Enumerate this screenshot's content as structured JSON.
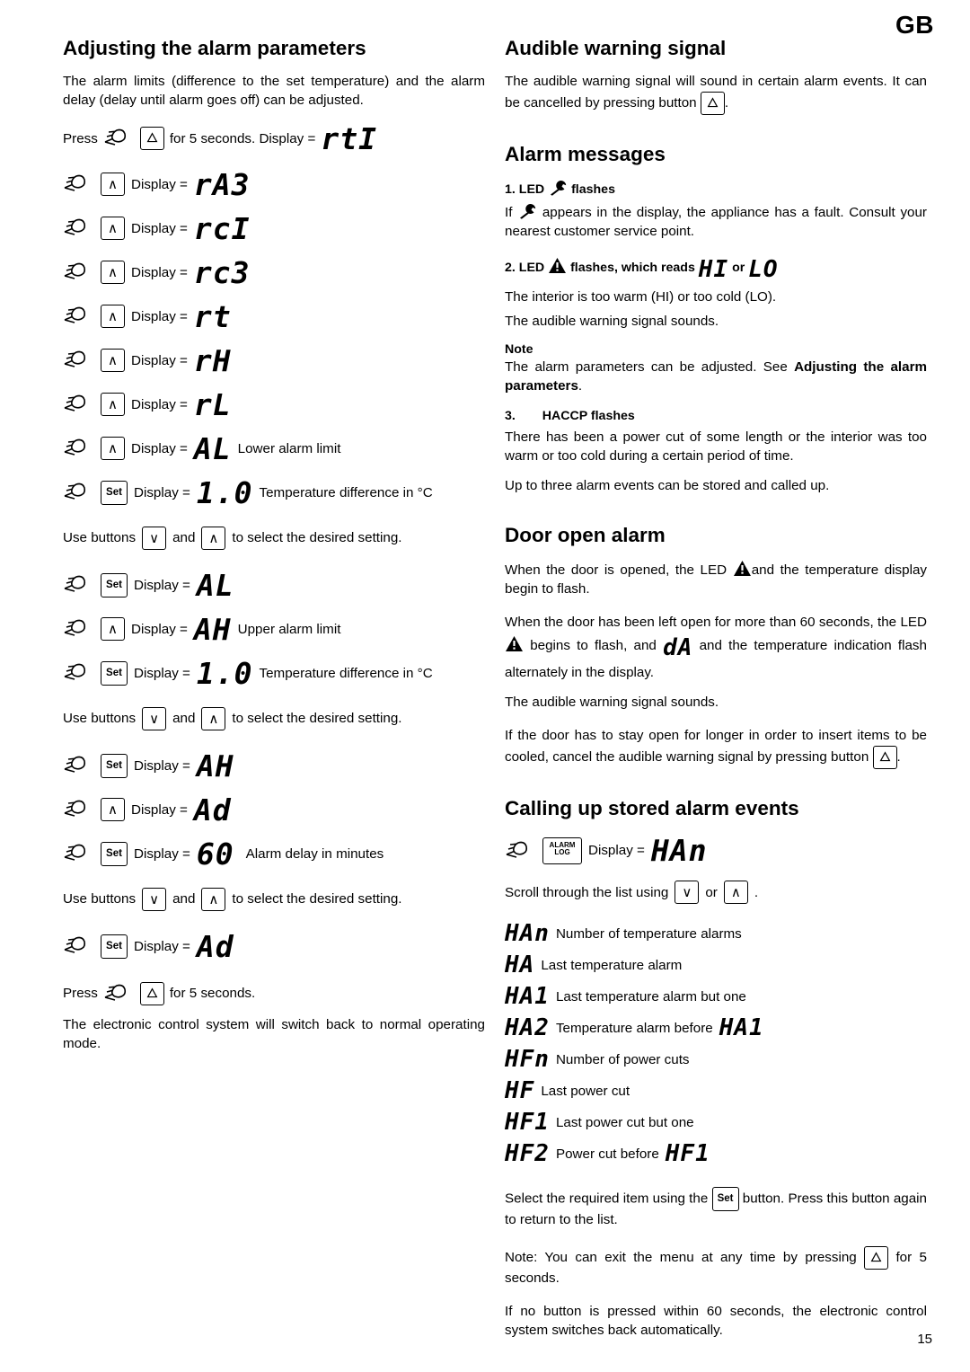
{
  "page": {
    "locale_tag": "GB",
    "number": "15"
  },
  "left": {
    "title": "Adjusting the alarm parameters",
    "intro": "The alarm limits (difference to the set temperature) and the alarm delay (delay until alarm goes off) can be adjusted.",
    "press_line": {
      "pre": "Press",
      "mid": "for 5 seconds. Display =",
      "display": "rtI"
    },
    "steps": [
      {
        "button": "up",
        "label": "Display =",
        "display": "rA3",
        "note": ""
      },
      {
        "button": "up",
        "label": "Display =",
        "display": "rcI",
        "note": ""
      },
      {
        "button": "up",
        "label": "Display =",
        "display": "rc3",
        "note": ""
      },
      {
        "button": "up",
        "label": "Display =",
        "display": "rt",
        "note": ""
      },
      {
        "button": "up",
        "label": "Display =",
        "display": "rH",
        "note": ""
      },
      {
        "button": "up",
        "label": "Display =",
        "display": "rL",
        "note": ""
      },
      {
        "button": "up",
        "label": "Display =",
        "display": "AL",
        "note": "Lower alarm limit"
      },
      {
        "button": "set",
        "label": "Display =",
        "display": "1.0",
        "note": "Temperature difference in °C"
      }
    ],
    "use_buttons_1": {
      "pre": "Use buttons",
      "mid": "and",
      "post": "to select the desired setting."
    },
    "steps2": [
      {
        "button": "set",
        "label": "Display =",
        "display": "AL",
        "note": ""
      },
      {
        "button": "up",
        "label": "Display =",
        "display": "AH",
        "note": "Upper alarm limit"
      },
      {
        "button": "set",
        "label": "Display =",
        "display": "1.0",
        "note": "Temperature difference in °C"
      }
    ],
    "use_buttons_2": {
      "pre": "Use buttons",
      "mid": "and",
      "post": "to select the desired setting."
    },
    "steps3": [
      {
        "button": "set",
        "label": "Display =",
        "display": "AH",
        "note": ""
      },
      {
        "button": "up",
        "label": "Display =",
        "display": "Ad",
        "note": ""
      },
      {
        "button": "set",
        "label": "Display =",
        "display": "60",
        "note": "Alarm delay in minutes"
      }
    ],
    "use_buttons_3": {
      "pre": "Use buttons",
      "mid": "and",
      "post": "to select the desired setting."
    },
    "steps4": [
      {
        "button": "set",
        "label": "Display =",
        "display": "Ad",
        "note": ""
      }
    ],
    "press_end": {
      "pre": "Press",
      "post": "for 5 seconds."
    },
    "closing": "The electronic control system will switch back to normal operating mode."
  },
  "right": {
    "audible": {
      "title": "Audible warning signal",
      "text_a": "The audible warning signal will sound in certain alarm events. It can be cancelled by pressing button",
      "text_b": "."
    },
    "alarm_messages": {
      "title": "Alarm messages",
      "item1_pre": "1. LED",
      "item1_post": "flashes",
      "item1_body_a": "If",
      "item1_body_b": "appears in the display, the appliance has a fault. Consult your nearest customer service point.",
      "item2_pre": "2. LED",
      "item2_mid": "flashes, which reads",
      "item2_hi": "HI",
      "item2_or": "or",
      "item2_lo": "LO",
      "item2_body": "The interior is too warm (HI) or too cold (LO).",
      "item2_body2": "The audible warning signal sounds.",
      "note_title": "Note",
      "note_a": "The alarm parameters can be adjusted. See ",
      "note_b": "Adjusting the alarm parameters",
      "note_c": ".",
      "item3_num": "3.",
      "item3_label": "HACCP flashes",
      "item3_body": "There has been a power cut of some length or the interior was too warm or too cold during a certain period of time.",
      "item3_body2": "Up to three alarm events can be stored and called up."
    },
    "door": {
      "title": "Door open alarm",
      "p1_a": "When the door is opened, the LED",
      "p1_b": "and the temperature display begin to flash.",
      "p2_a": "When the door has been left open for more than 60 seconds, the LED",
      "p2_b": "begins to flash, and",
      "p2_seg": "dA",
      "p2_c": "and the temperature indication flash alternately in the display.",
      "p3": "The audible warning signal sounds.",
      "p4_a": "If the door has to stay open for longer in order to insert items to be cooled, cancel the audible warning signal by pressing button",
      "p4_b": "."
    },
    "calling": {
      "title": "Calling up stored alarm events",
      "log_button_line1": "ALARM",
      "log_button_line2": "LOG",
      "display_label": "Display =",
      "display_value": "HAn",
      "scroll_a": "Scroll through the list using",
      "scroll_or": "or",
      "scroll_b": ".",
      "items": [
        {
          "code": "HAn",
          "text": "Number of temperature alarms",
          "code2": ""
        },
        {
          "code": "HA",
          "text": "Last temperature alarm",
          "code2": ""
        },
        {
          "code": "HA1",
          "text": "Last temperature alarm but one",
          "code2": ""
        },
        {
          "code": "HA2",
          "text": "Temperature alarm before",
          "code2": "HA1"
        },
        {
          "code": "HFn",
          "text": "Number of power cuts",
          "code2": ""
        },
        {
          "code": "HF",
          "text": "Last power cut",
          "code2": ""
        },
        {
          "code": "HF1",
          "text": "Last power cut but one",
          "code2": ""
        },
        {
          "code": "HF2",
          "text": "Power cut before",
          "code2": "HF1"
        }
      ],
      "select_a": "Select the required item using the",
      "select_b": "button. Press this button again to return to the list.",
      "note_a": "Note: You can exit the menu at any time by pressing",
      "note_b": "for 5 seconds.",
      "auto": "If no button is pressed within 60 seconds, the electronic control system switches back automatically."
    }
  },
  "icons": {
    "up": "∧",
    "down": "∨",
    "set": "Set",
    "bell": "⚠"
  }
}
